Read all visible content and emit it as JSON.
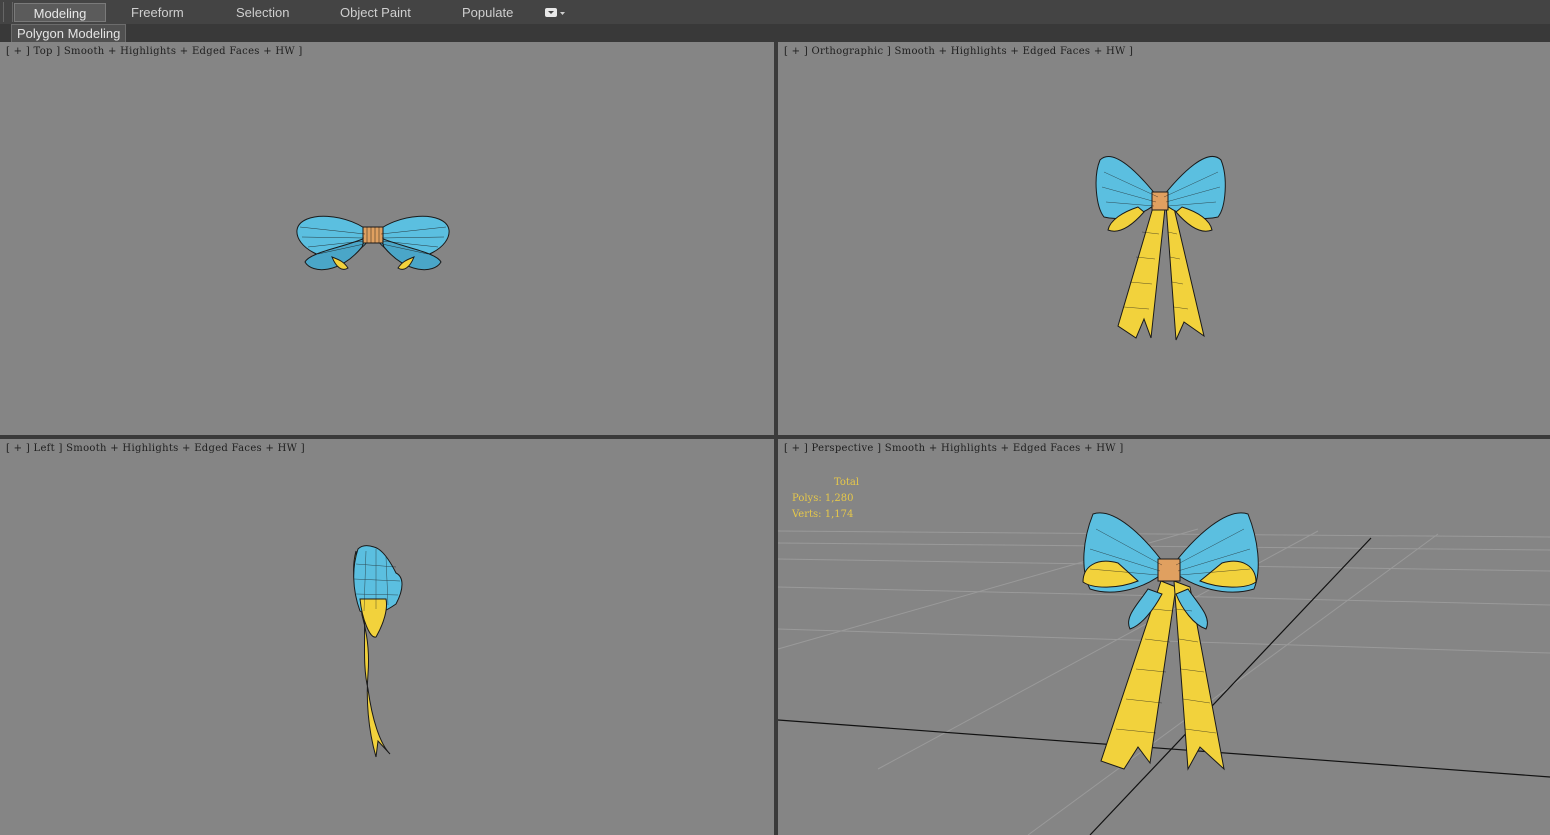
{
  "ribbon": {
    "tabs": [
      {
        "label": "Modeling",
        "active": true
      },
      {
        "label": "Freeform",
        "active": false
      },
      {
        "label": "Selection",
        "active": false
      },
      {
        "label": "Object Paint",
        "active": false
      },
      {
        "label": "Populate",
        "active": false
      }
    ],
    "dropdown_icon": "options-dropdown-icon",
    "panel_button": "Polygon Modeling"
  },
  "viewports": {
    "top": {
      "label": "[ + ] Top ] Smooth + Highlights + Edged Faces + HW ]"
    },
    "ortho": {
      "label": "[ + ] Orthographic ] Smooth + Highlights + Edged Faces + HW ]"
    },
    "left": {
      "label": "[ + ] Left ] Smooth + Highlights + Edged Faces + HW ]"
    },
    "persp": {
      "label": "[ + ] Perspective ] Smooth + Highlights + Edged Faces + HW ]",
      "stats": {
        "total": "Total",
        "polys": "Polys: 1,280",
        "verts": "Verts: 1,174"
      }
    }
  },
  "colors": {
    "viewport_bg": "#858585",
    "bow_blue": "#5bbfe0",
    "bow_yellow": "#f2d23c",
    "knot": "#e0a060",
    "stats_text": "#e6c84a"
  }
}
